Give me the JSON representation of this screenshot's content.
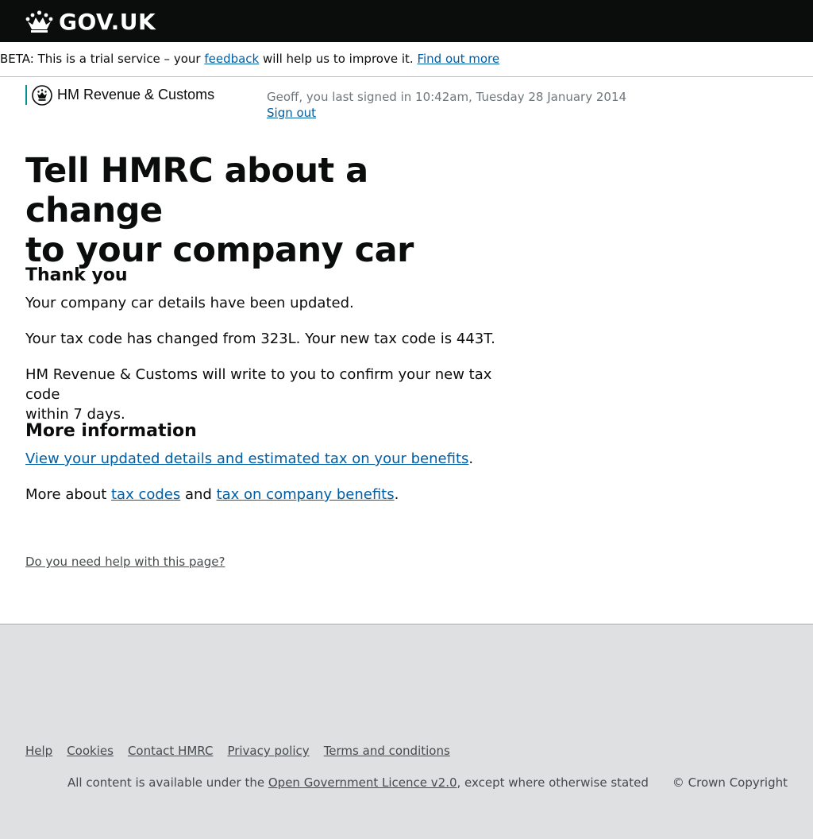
{
  "header": {
    "logo_text": "GOV.UK"
  },
  "beta_banner": {
    "prefix": "BETA: This is a trial service – your ",
    "feedback_link": "feedback",
    "middle": " will help us to improve it. ",
    "find_out_more_link": "Find out more"
  },
  "department": {
    "name": "HM Revenue & Customs"
  },
  "account": {
    "last_signed_in": "Geoff, you last signed in 10:42am, Tuesday 28 January 2014",
    "sign_out_link": "Sign out"
  },
  "main": {
    "heading_line1": "Tell HMRC about a change",
    "heading_line2": "to your company car",
    "thank_you_heading": "Thank you",
    "details_updated": "Your company car details have been updated.",
    "tax_code_changed": "Your tax code has changed from 323L. Your new tax code is 443T.",
    "confirmation_line1": "HM Revenue & Customs will write to you to confirm your new tax code",
    "confirmation_line2": "within 7 days.",
    "more_info_heading": "More information",
    "view_details_link": "View your updated details and estimated tax on your benefits",
    "period": ".",
    "more_about_prefix": "More about ",
    "tax_codes_link": "tax codes",
    "and_text": " and ",
    "company_benefits_link": "tax on company benefits",
    "help_link": "Do you need help with this page?"
  },
  "footer": {
    "links": [
      "Help",
      "Cookies",
      "Contact HMRC",
      "Privacy policy",
      "Terms and conditions"
    ],
    "licence_prefix": "All content is available under the ",
    "licence_link": "Open Government Licence v2.0",
    "licence_suffix": ", except where otherwise stated",
    "copyright": "© Crown Copyright"
  },
  "colors": {
    "header_bg": "#0b0c0c",
    "link": "#005ea5",
    "dept_rule": "#009390",
    "footer_bg": "#dee0e2"
  }
}
